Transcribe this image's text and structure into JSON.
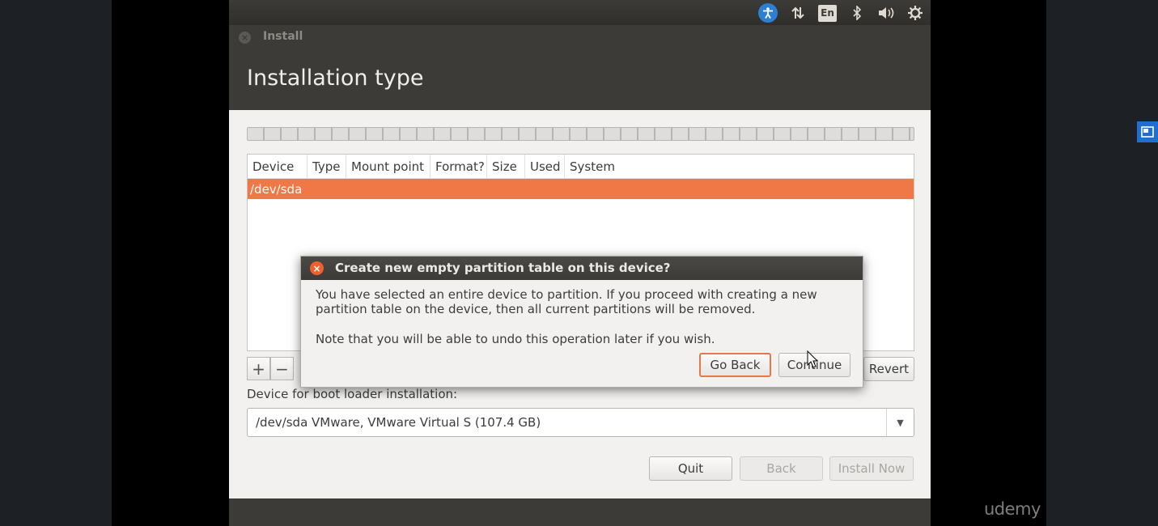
{
  "panel": {
    "language": "En",
    "icons": [
      "accessibility-icon",
      "network-icon",
      "keyboard-language-icon",
      "bluetooth-icon",
      "volume-icon",
      "settings-gear-icon"
    ]
  },
  "window": {
    "title": "Install",
    "heading": "Installation type"
  },
  "table": {
    "columns": [
      "Device",
      "Type",
      "Mount point",
      "Format?",
      "Size",
      "Used",
      "System"
    ],
    "rows": [
      {
        "device": "/dev/sda",
        "selected": true
      }
    ],
    "selected_color": "#f07746"
  },
  "partition_toolbar": {
    "add": "+",
    "remove": "−",
    "revert": "Revert"
  },
  "boot_loader": {
    "label": "Device for boot loader installation:",
    "value": "/dev/sda  VMware, VMware Virtual S (107.4 GB)"
  },
  "actions": {
    "quit": "Quit",
    "back": "Back",
    "install_now": "Install Now"
  },
  "dialog": {
    "title": "Create new empty partition table on this device?",
    "message": "You have selected an entire device to partition. If you proceed with creating a new partition table on the device, then all current partitions will be removed.",
    "note": "Note that you will be able to undo this operation later if you wish.",
    "go_back": "Go Back",
    "continue": "Continue"
  },
  "watermark": "udemy"
}
